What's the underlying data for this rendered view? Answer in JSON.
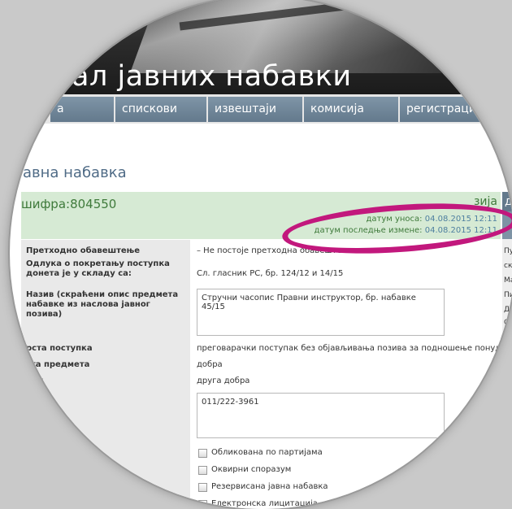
{
  "header": {
    "title": "ал јавних набавки"
  },
  "nav": {
    "tabs": [
      {
        "label": "а"
      },
      {
        "label": "спискови"
      },
      {
        "label": "извештаји"
      },
      {
        "label": "комисија"
      },
      {
        "label": "регистраци"
      }
    ]
  },
  "page": {
    "heading": "авна набавка",
    "sifra": "шифра:804550",
    "version_partial": "зија",
    "datum_unosa_label": "датум уноса:",
    "datum_unosa_value": "04.08.2015 12:11",
    "datum_izmene_label": "датум последње измене:",
    "datum_izmene_value": "04.08.2015 12:11",
    "side_tab_char": "д"
  },
  "form": {
    "fields": [
      {
        "label": "Претходно обавештење",
        "value": "– Не постоје претходна обавештења –"
      },
      {
        "label": "Одлука о покретању поступка донета је у складу са:",
        "value": "Сл. гласник РС, бр. 124/12 и 14/15"
      },
      {
        "label": "Назив (скраћени опис предмета набавке из наслова јавног позива)",
        "value": "Стручни часопис Правни инструктор, бр. набавке 45/15"
      },
      {
        "label": "рста поступка",
        "value": "преговарачки поступак без објављивања позива за подношење понуда"
      },
      {
        "label": "ста предмета",
        "value": "добра"
      },
      {
        "label": "мет",
        "value": "друга добра"
      },
      {
        "label": "",
        "value": "011/222-3961"
      }
    ],
    "checkboxes": [
      {
        "label": "Обликована по партијама"
      },
      {
        "label": "Оквирни споразум"
      },
      {
        "label": "Резервисана јавна набавка"
      },
      {
        "label": "Електронска лицитација"
      }
    ]
  },
  "right_column": {
    "items": [
      "Пу",
      "ск",
      "Ма",
      "Пи",
      "Др",
      "О"
    ]
  }
}
